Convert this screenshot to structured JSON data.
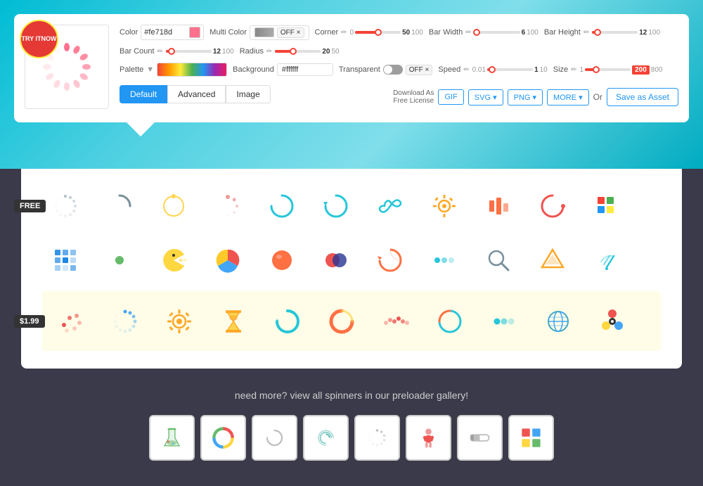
{
  "topSection": {
    "badge": {
      "line1": "TRY IT",
      "line2": "NOW"
    },
    "color": {
      "label": "Color",
      "value": "#fe718d",
      "swatch": "#fe718d"
    },
    "multiColor": {
      "label": "Multi Color",
      "offLabel": "OFF ×"
    },
    "corner": {
      "label": "Corner",
      "min": 0,
      "max": 100,
      "value": 50,
      "fillPct": 50
    },
    "barWidth": {
      "label": "Bar Width",
      "min": 0,
      "max": 100,
      "value": 6,
      "fillPct": 6
    },
    "barHeight": {
      "label": "Bar Height",
      "min": 0,
      "max": 100,
      "value": 12,
      "fillPct": 12
    },
    "barCount": {
      "label": "Bar Count",
      "min": 0,
      "max": 100,
      "value": 12,
      "fillPct": 12
    },
    "radius": {
      "label": "Radius",
      "min": 0,
      "max": 50,
      "value": 20,
      "fillPct": 40
    },
    "palette": {
      "label": "Palette"
    },
    "background": {
      "label": "Background",
      "value": "#ffffff"
    },
    "transparent": {
      "label": "Transparent",
      "offLabel": "OFF ×"
    },
    "speed": {
      "label": "Speed",
      "min": 0,
      "max": 10,
      "value": 1,
      "fillPct": 10
    },
    "size": {
      "label": "Size",
      "min": 1,
      "max": 800,
      "value": 200,
      "fillPct": 25
    },
    "tabs": {
      "default": "Default",
      "advanced": "Advanced",
      "image": "Image"
    },
    "download": {
      "label1": "Download As",
      "label2": "Free License",
      "gif": "GIF",
      "svg": "SVG ▾",
      "png": "PNG ▾",
      "more": "MORE ▾",
      "or": "Or",
      "saveAsset": "Save as Asset"
    }
  },
  "gallery": {
    "freeBadge": "FREE",
    "paidBadge": "$1.99",
    "bottomText": "need more? view all spinners in our preloader gallery!"
  }
}
